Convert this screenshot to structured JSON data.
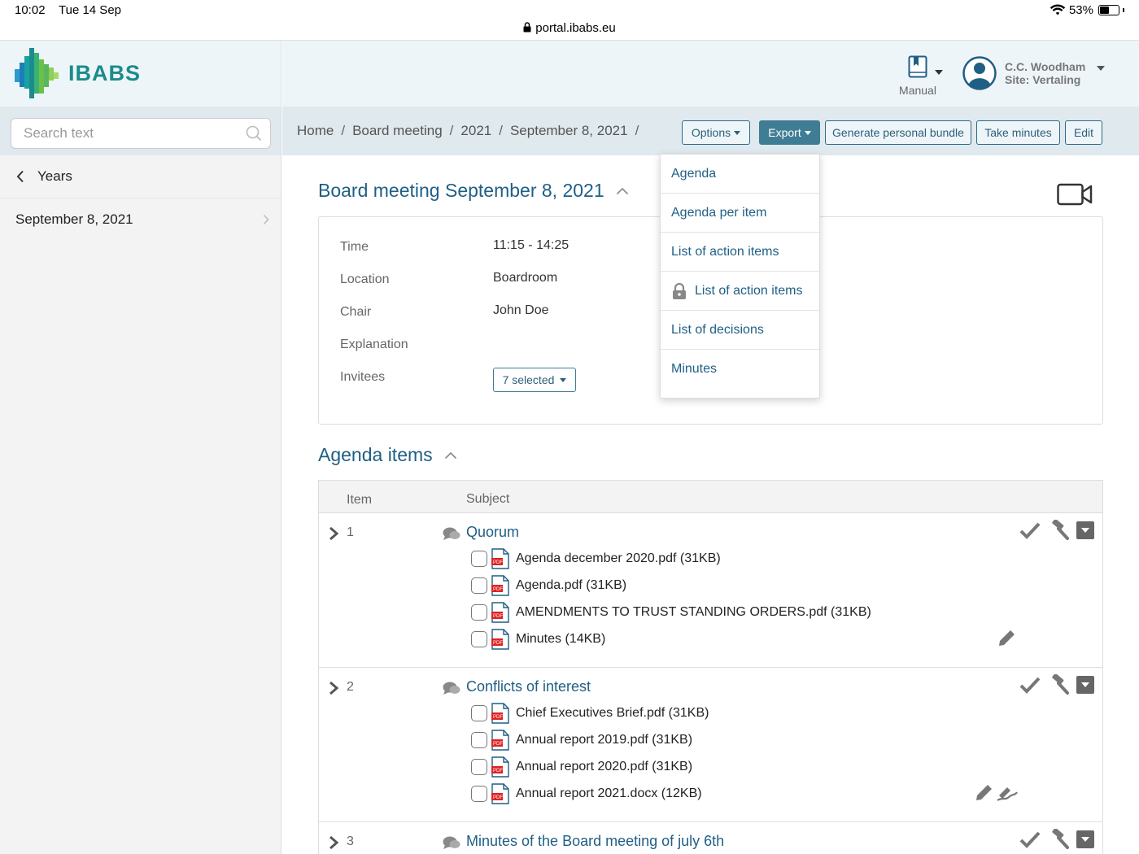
{
  "status_bar": {
    "time": "10:02",
    "date": "Tue 14 Sep",
    "url": "portal.ibabs.eu",
    "battery": "53%",
    "battery_level": 0.53
  },
  "brand": {
    "name": "IBABS",
    "accent": "#1f5f85",
    "logo_color": "#1b8b8d"
  },
  "sidebar": {
    "search_placeholder": "Search text",
    "back_label": "Years",
    "items": [
      {
        "label": "September 8, 2021"
      }
    ]
  },
  "header": {
    "manual_label": "Manual",
    "user_name": "C.C. Woodham",
    "user_site": "Site: Vertaling"
  },
  "breadcrumb": [
    "Home",
    "Board meeting",
    "2021",
    "September 8, 2021"
  ],
  "toolbar": {
    "options_label": "Options",
    "export_label": "Export",
    "bundle_label": "Generate personal bundle",
    "minutes_label": "Take minutes",
    "edit_label": "Edit"
  },
  "meeting": {
    "title": "Board meeting September 8, 2021",
    "details": [
      {
        "label": "Time",
        "value": "11:15 - 14:25"
      },
      {
        "label": "Location",
        "value": "Boardroom"
      },
      {
        "label": "Chair",
        "value": "John Doe"
      },
      {
        "label": "Explanation",
        "value": ""
      },
      {
        "label": "Invitees",
        "value": "7 selected"
      }
    ]
  },
  "agenda": {
    "title": "Agenda items",
    "columns": [
      "Item",
      "Subject"
    ],
    "items": [
      {
        "number": "1",
        "subject": "Quorum",
        "documents": [
          "Agenda december 2020.pdf (31KB)",
          "Agenda.pdf (31KB)",
          "AMENDMENTS TO TRUST STANDING ORDERS.pdf (31KB)",
          "Minutes (14KB)"
        ]
      },
      {
        "number": "2",
        "subject": "Conflicts of interest",
        "documents": [
          "Chief Executives Brief.pdf (31KB)",
          "Annual report 2019.pdf (31KB)",
          "Annual report 2020.pdf (31KB)",
          "Annual report 2021.docx (12KB)"
        ]
      },
      {
        "number": "3",
        "subject": "Minutes of the Board meeting of july 6th",
        "documents": []
      }
    ]
  },
  "export_menu": {
    "items": [
      {
        "label": "Agenda",
        "locked": false
      },
      {
        "label": "Agenda per item",
        "locked": false
      },
      {
        "label": "List of action items",
        "locked": false
      },
      {
        "label": "List of action items",
        "locked": true
      },
      {
        "label": "List of decisions",
        "locked": false
      },
      {
        "label": "Minutes",
        "locked": false
      }
    ]
  }
}
